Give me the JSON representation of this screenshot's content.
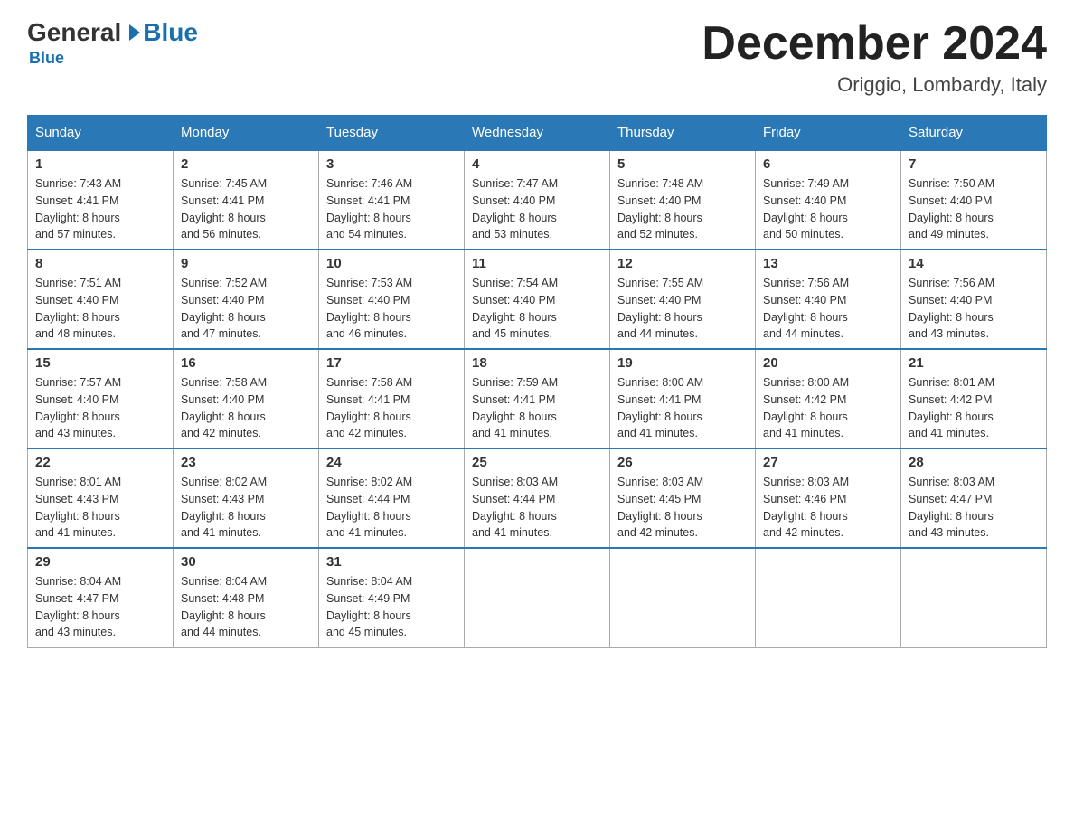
{
  "header": {
    "logo_general": "General",
    "logo_blue": "Blue",
    "month_title": "December 2024",
    "location": "Origgio, Lombardy, Italy"
  },
  "days_of_week": [
    "Sunday",
    "Monday",
    "Tuesday",
    "Wednesday",
    "Thursday",
    "Friday",
    "Saturday"
  ],
  "weeks": [
    [
      {
        "day": "1",
        "sunrise": "7:43 AM",
        "sunset": "4:41 PM",
        "daylight_hours": "8",
        "daylight_minutes": "57"
      },
      {
        "day": "2",
        "sunrise": "7:45 AM",
        "sunset": "4:41 PM",
        "daylight_hours": "8",
        "daylight_minutes": "56"
      },
      {
        "day": "3",
        "sunrise": "7:46 AM",
        "sunset": "4:41 PM",
        "daylight_hours": "8",
        "daylight_minutes": "54"
      },
      {
        "day": "4",
        "sunrise": "7:47 AM",
        "sunset": "4:40 PM",
        "daylight_hours": "8",
        "daylight_minutes": "53"
      },
      {
        "day": "5",
        "sunrise": "7:48 AM",
        "sunset": "4:40 PM",
        "daylight_hours": "8",
        "daylight_minutes": "52"
      },
      {
        "day": "6",
        "sunrise": "7:49 AM",
        "sunset": "4:40 PM",
        "daylight_hours": "8",
        "daylight_minutes": "50"
      },
      {
        "day": "7",
        "sunrise": "7:50 AM",
        "sunset": "4:40 PM",
        "daylight_hours": "8",
        "daylight_minutes": "49"
      }
    ],
    [
      {
        "day": "8",
        "sunrise": "7:51 AM",
        "sunset": "4:40 PM",
        "daylight_hours": "8",
        "daylight_minutes": "48"
      },
      {
        "day": "9",
        "sunrise": "7:52 AM",
        "sunset": "4:40 PM",
        "daylight_hours": "8",
        "daylight_minutes": "47"
      },
      {
        "day": "10",
        "sunrise": "7:53 AM",
        "sunset": "4:40 PM",
        "daylight_hours": "8",
        "daylight_minutes": "46"
      },
      {
        "day": "11",
        "sunrise": "7:54 AM",
        "sunset": "4:40 PM",
        "daylight_hours": "8",
        "daylight_minutes": "45"
      },
      {
        "day": "12",
        "sunrise": "7:55 AM",
        "sunset": "4:40 PM",
        "daylight_hours": "8",
        "daylight_minutes": "44"
      },
      {
        "day": "13",
        "sunrise": "7:56 AM",
        "sunset": "4:40 PM",
        "daylight_hours": "8",
        "daylight_minutes": "44"
      },
      {
        "day": "14",
        "sunrise": "7:56 AM",
        "sunset": "4:40 PM",
        "daylight_hours": "8",
        "daylight_minutes": "43"
      }
    ],
    [
      {
        "day": "15",
        "sunrise": "7:57 AM",
        "sunset": "4:40 PM",
        "daylight_hours": "8",
        "daylight_minutes": "43"
      },
      {
        "day": "16",
        "sunrise": "7:58 AM",
        "sunset": "4:40 PM",
        "daylight_hours": "8",
        "daylight_minutes": "42"
      },
      {
        "day": "17",
        "sunrise": "7:58 AM",
        "sunset": "4:41 PM",
        "daylight_hours": "8",
        "daylight_minutes": "42"
      },
      {
        "day": "18",
        "sunrise": "7:59 AM",
        "sunset": "4:41 PM",
        "daylight_hours": "8",
        "daylight_minutes": "41"
      },
      {
        "day": "19",
        "sunrise": "8:00 AM",
        "sunset": "4:41 PM",
        "daylight_hours": "8",
        "daylight_minutes": "41"
      },
      {
        "day": "20",
        "sunrise": "8:00 AM",
        "sunset": "4:42 PM",
        "daylight_hours": "8",
        "daylight_minutes": "41"
      },
      {
        "day": "21",
        "sunrise": "8:01 AM",
        "sunset": "4:42 PM",
        "daylight_hours": "8",
        "daylight_minutes": "41"
      }
    ],
    [
      {
        "day": "22",
        "sunrise": "8:01 AM",
        "sunset": "4:43 PM",
        "daylight_hours": "8",
        "daylight_minutes": "41"
      },
      {
        "day": "23",
        "sunrise": "8:02 AM",
        "sunset": "4:43 PM",
        "daylight_hours": "8",
        "daylight_minutes": "41"
      },
      {
        "day": "24",
        "sunrise": "8:02 AM",
        "sunset": "4:44 PM",
        "daylight_hours": "8",
        "daylight_minutes": "41"
      },
      {
        "day": "25",
        "sunrise": "8:03 AM",
        "sunset": "4:44 PM",
        "daylight_hours": "8",
        "daylight_minutes": "41"
      },
      {
        "day": "26",
        "sunrise": "8:03 AM",
        "sunset": "4:45 PM",
        "daylight_hours": "8",
        "daylight_minutes": "42"
      },
      {
        "day": "27",
        "sunrise": "8:03 AM",
        "sunset": "4:46 PM",
        "daylight_hours": "8",
        "daylight_minutes": "42"
      },
      {
        "day": "28",
        "sunrise": "8:03 AM",
        "sunset": "4:47 PM",
        "daylight_hours": "8",
        "daylight_minutes": "43"
      }
    ],
    [
      {
        "day": "29",
        "sunrise": "8:04 AM",
        "sunset": "4:47 PM",
        "daylight_hours": "8",
        "daylight_minutes": "43"
      },
      {
        "day": "30",
        "sunrise": "8:04 AM",
        "sunset": "4:48 PM",
        "daylight_hours": "8",
        "daylight_minutes": "44"
      },
      {
        "day": "31",
        "sunrise": "8:04 AM",
        "sunset": "4:49 PM",
        "daylight_hours": "8",
        "daylight_minutes": "45"
      },
      null,
      null,
      null,
      null
    ]
  ]
}
